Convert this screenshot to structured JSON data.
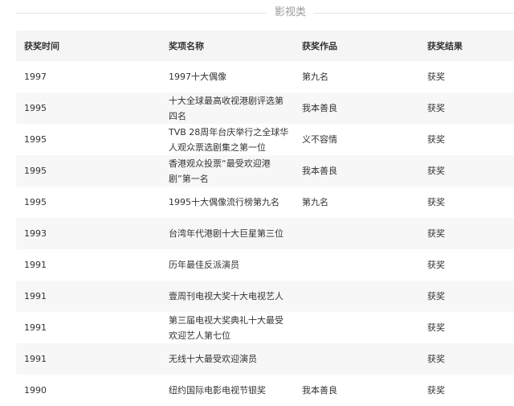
{
  "section": {
    "title": "影视类"
  },
  "table": {
    "headers": [
      "获奖时间",
      "奖项名称",
      "获奖作品",
      "获奖结果"
    ],
    "rows": [
      {
        "year": "1997",
        "award": "1997十大偶像",
        "work": "第九名",
        "result": "获奖"
      },
      {
        "year": "1995",
        "award": "十大全球最高收视港剧评选第四名",
        "work": "我本善良",
        "result": "获奖"
      },
      {
        "year": "1995",
        "award": "TVB 28周年台庆举行之全球华人观众票选剧集之第一位",
        "work": "义不容情",
        "result": "获奖"
      },
      {
        "year": "1995",
        "award": "香港观众投票“最受欢迎港剧”第一名",
        "work": "我本善良",
        "result": "获奖"
      },
      {
        "year": "1995",
        "award": "1995十大偶像流行榜第九名",
        "work": "第九名",
        "result": "获奖"
      },
      {
        "year": "1993",
        "award": "台湾年代港剧十大巨星第三位",
        "work": "",
        "result": "获奖"
      },
      {
        "year": "1991",
        "award": "历年最佳反派演员",
        "work": "",
        "result": "获奖"
      },
      {
        "year": "1991",
        "award": "壹周刊电视大奖十大电视艺人",
        "work": "",
        "result": "获奖"
      },
      {
        "year": "1991",
        "award": "第三届电视大奖典礼十大最受欢迎艺人第七位",
        "work": "",
        "result": "获奖"
      },
      {
        "year": "1991",
        "award": "无线十大最受欢迎演员",
        "work": "",
        "result": "获奖"
      },
      {
        "year": "1990",
        "award": "纽约国际电影电视节银奖",
        "work": "我本善良",
        "result": "获奖"
      }
    ]
  }
}
